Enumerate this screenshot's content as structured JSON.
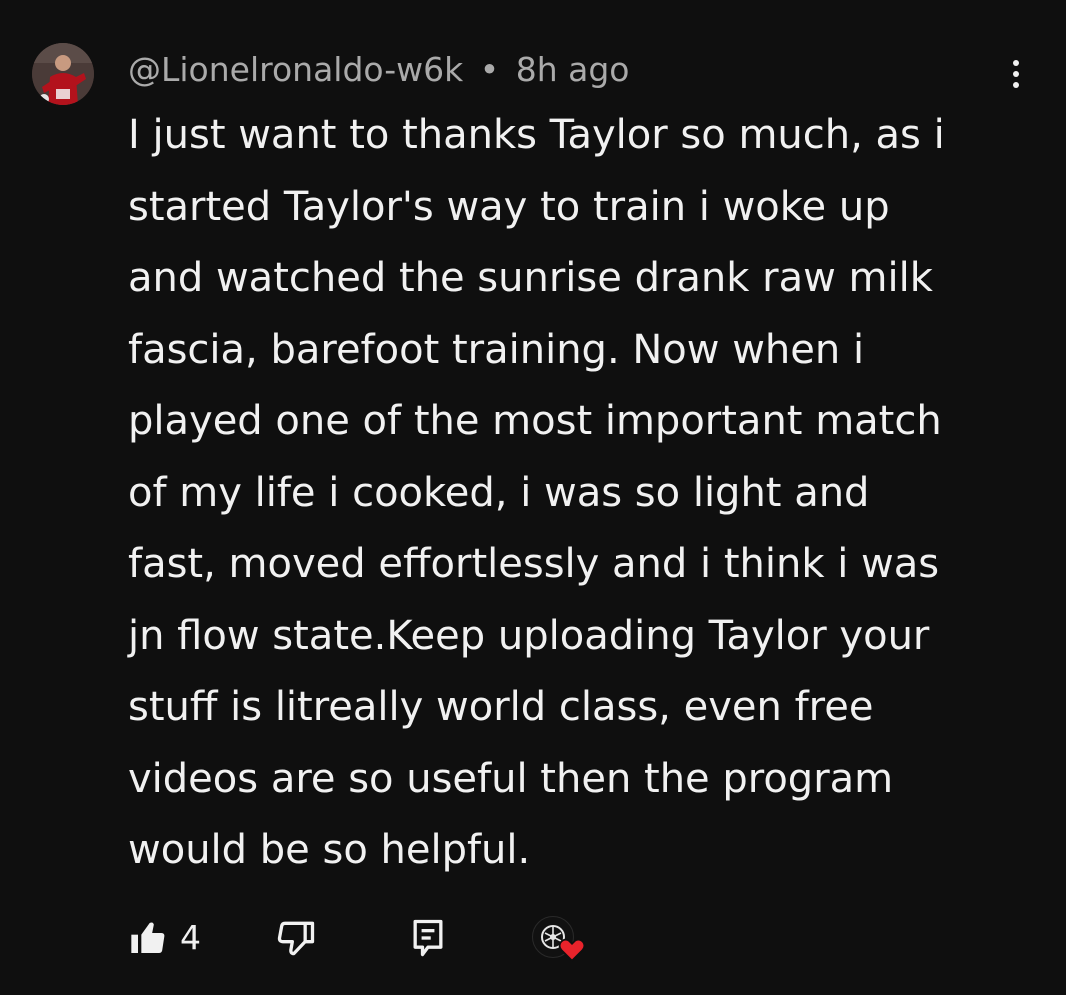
{
  "comment": {
    "author": "@Lionelronaldo-w6k",
    "separator": "•",
    "time": "8h ago",
    "text_lines": [
      "I just want to thanks Taylor so much, as i",
      "started Taylor's way to train i woke up",
      "and watched the sunrise drank raw milk",
      "fascia, barefoot training. Now when i",
      "played one of the most important match",
      "of my life i cooked, i was so light and",
      "fast, moved effortlessly and i think i was",
      "jn flow state.Keep uploading Taylor your",
      "stuff is litreally world class, even free",
      "videos are so useful then the program",
      "would be so helpful."
    ]
  },
  "actions": {
    "like_icon": "thumbs-up-icon",
    "like_count": "4",
    "dislike_icon": "thumbs-down-icon",
    "reply_icon": "reply-icon",
    "creator_heart_icon": "heart-icon"
  },
  "menu": {
    "icon": "more-vertical-icon"
  },
  "colors": {
    "background": "#0f0f0f",
    "text_primary": "#f1f1f1",
    "text_secondary": "#aaaaaa",
    "heart": "#e8232b"
  }
}
